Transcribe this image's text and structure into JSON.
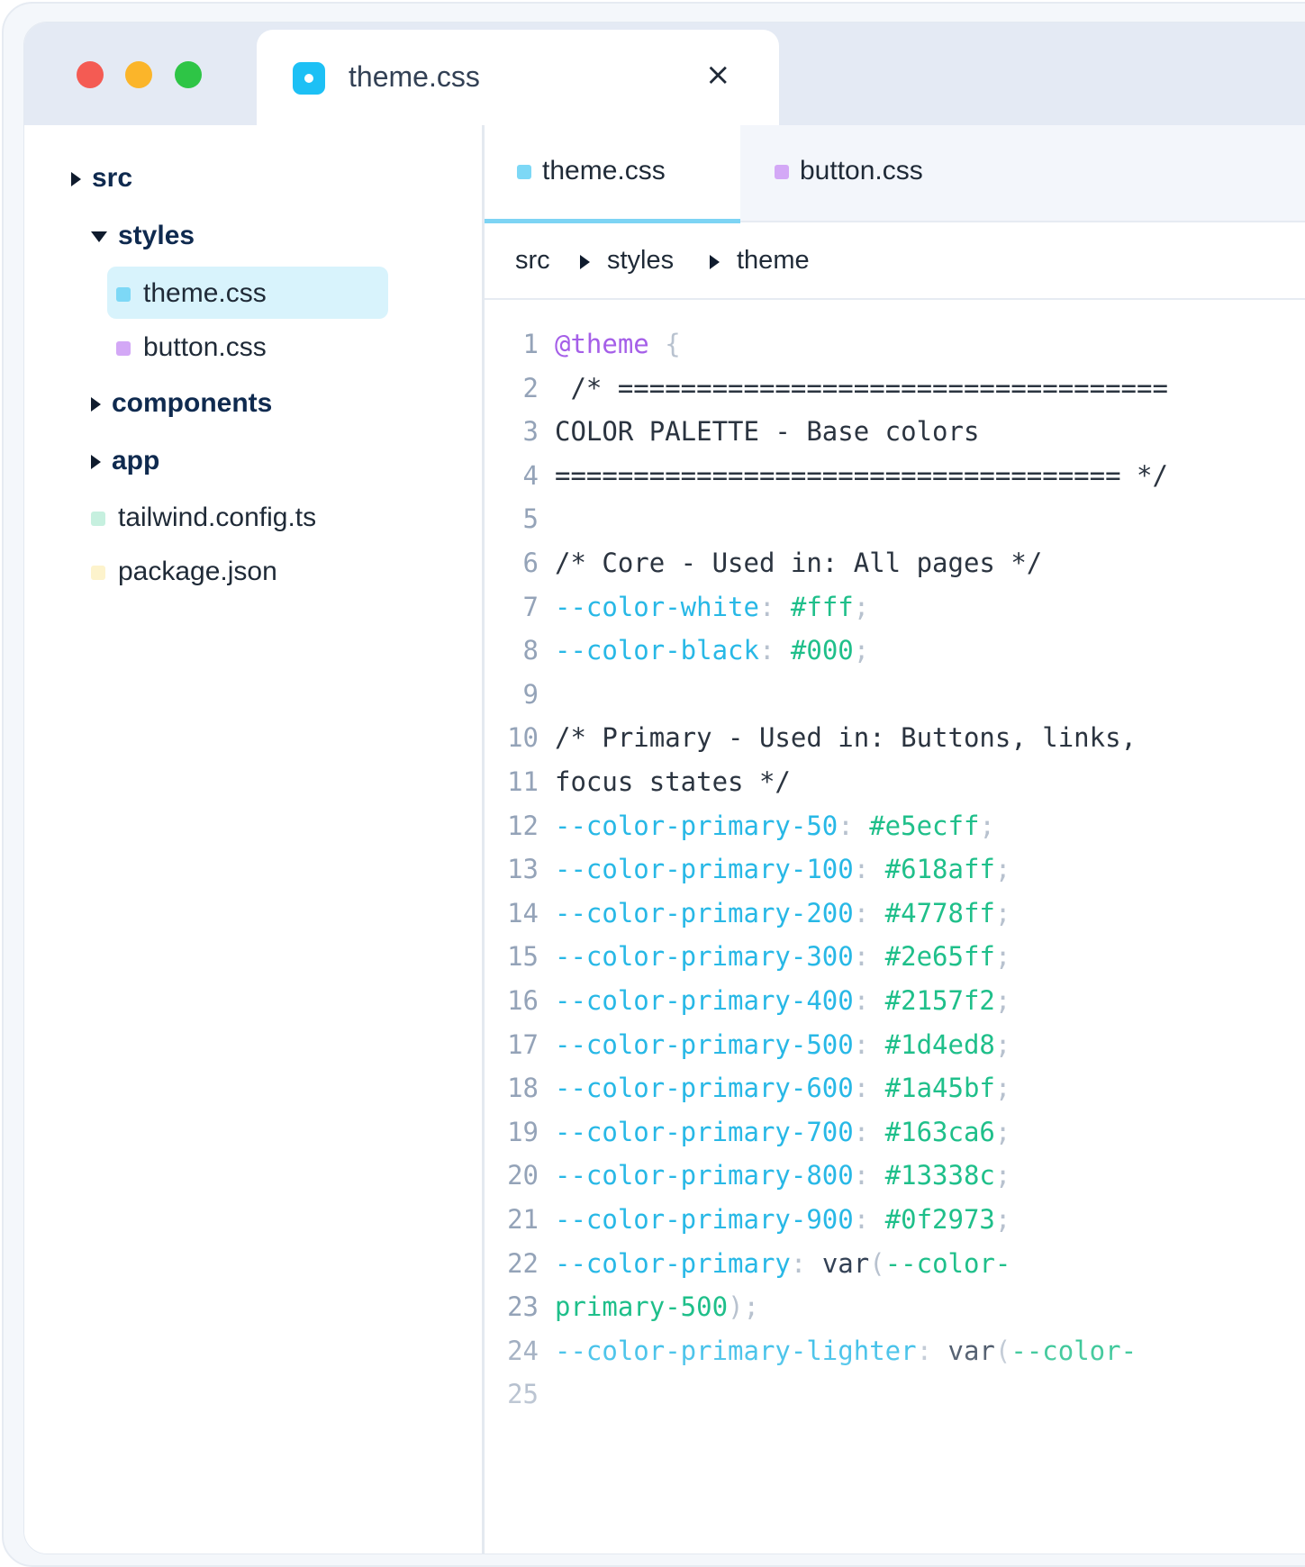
{
  "window": {
    "tab_title": "theme.css",
    "tab_icon": "css-file-icon",
    "close_symbol": "×"
  },
  "sidebar": {
    "items": [
      {
        "label": "src",
        "type": "folder",
        "state": "collapsed"
      },
      {
        "label": "styles",
        "type": "folder",
        "state": "expanded"
      },
      {
        "label": "theme.css",
        "type": "file",
        "color": "#7dd8f6",
        "selected": true
      },
      {
        "label": "button.css",
        "type": "file",
        "color": "#d3a8f6"
      },
      {
        "label": "components",
        "type": "folder",
        "state": "collapsed"
      },
      {
        "label": "app",
        "type": "folder",
        "state": "collapsed"
      },
      {
        "label": "tailwind.config.ts",
        "type": "file",
        "color": "#c6f0df"
      },
      {
        "label": "package.json",
        "type": "file",
        "color": "#fdf3cc"
      }
    ]
  },
  "editor": {
    "tabs": [
      {
        "label": "theme.css",
        "color": "#7dd8f6",
        "active": true
      },
      {
        "label": "button.css",
        "color": "#d3a8f6",
        "active": false
      }
    ],
    "breadcrumb": [
      "src",
      "styles",
      "theme"
    ],
    "lines": [
      {
        "n": "1",
        "tokens": [
          {
            "t": "@theme",
            "c": "at"
          },
          {
            "t": " {",
            "c": "brace"
          }
        ]
      },
      {
        "n": "2",
        "tokens": [
          {
            "t": " /* ===================================",
            "c": "cm"
          }
        ]
      },
      {
        "n": "3",
        "tokens": [
          {
            "t": "COLOR PALETTE - Base colors",
            "c": "cm"
          }
        ]
      },
      {
        "n": "4",
        "tokens": [
          {
            "t": "==================================== */",
            "c": "cm"
          }
        ]
      },
      {
        "n": "5",
        "tokens": []
      },
      {
        "n": "6",
        "tokens": [
          {
            "t": "/* Core - Used in: All pages */",
            "c": "cm"
          }
        ]
      },
      {
        "n": "7",
        "tokens": [
          {
            "t": "--color-white",
            "c": "prop"
          },
          {
            "t": ": ",
            "c": "punc"
          },
          {
            "t": "#fff",
            "c": "val"
          },
          {
            "t": ";",
            "c": "punc"
          }
        ]
      },
      {
        "n": "8",
        "tokens": [
          {
            "t": "--color-black",
            "c": "prop"
          },
          {
            "t": ": ",
            "c": "punc"
          },
          {
            "t": "#000",
            "c": "val"
          },
          {
            "t": ";",
            "c": "punc"
          }
        ]
      },
      {
        "n": "9",
        "tokens": []
      },
      {
        "n": "10",
        "tokens": [
          {
            "t": "/* Primary - Used in: Buttons, links,",
            "c": "cm"
          }
        ]
      },
      {
        "n": "11",
        "tokens": [
          {
            "t": "focus states */",
            "c": "cm"
          }
        ]
      },
      {
        "n": "12",
        "tokens": [
          {
            "t": "--color-primary-50",
            "c": "prop"
          },
          {
            "t": ": ",
            "c": "punc"
          },
          {
            "t": "#e5ecff",
            "c": "val"
          },
          {
            "t": ";",
            "c": "punc"
          }
        ]
      },
      {
        "n": "13",
        "tokens": [
          {
            "t": "--color-primary-100",
            "c": "prop"
          },
          {
            "t": ": ",
            "c": "punc"
          },
          {
            "t": "#618aff",
            "c": "val"
          },
          {
            "t": ";",
            "c": "punc"
          }
        ]
      },
      {
        "n": "14",
        "tokens": [
          {
            "t": "--color-primary-200",
            "c": "prop"
          },
          {
            "t": ": ",
            "c": "punc"
          },
          {
            "t": "#4778ff",
            "c": "val"
          },
          {
            "t": ";",
            "c": "punc"
          }
        ]
      },
      {
        "n": "15",
        "tokens": [
          {
            "t": "--color-primary-300",
            "c": "prop"
          },
          {
            "t": ": ",
            "c": "punc"
          },
          {
            "t": "#2e65ff",
            "c": "val"
          },
          {
            "t": ";",
            "c": "punc"
          }
        ]
      },
      {
        "n": "16",
        "tokens": [
          {
            "t": "--color-primary-400",
            "c": "prop"
          },
          {
            "t": ": ",
            "c": "punc"
          },
          {
            "t": "#2157f2",
            "c": "val"
          },
          {
            "t": ";",
            "c": "punc"
          }
        ]
      },
      {
        "n": "17",
        "tokens": [
          {
            "t": "--color-primary-500",
            "c": "prop"
          },
          {
            "t": ": ",
            "c": "punc"
          },
          {
            "t": "#1d4ed8",
            "c": "val"
          },
          {
            "t": ";",
            "c": "punc"
          }
        ]
      },
      {
        "n": "18",
        "tokens": [
          {
            "t": "--color-primary-600",
            "c": "prop"
          },
          {
            "t": ": ",
            "c": "punc"
          },
          {
            "t": "#1a45bf",
            "c": "val"
          },
          {
            "t": ";",
            "c": "punc"
          }
        ]
      },
      {
        "n": "19",
        "tokens": [
          {
            "t": "--color-primary-700",
            "c": "prop"
          },
          {
            "t": ": ",
            "c": "punc"
          },
          {
            "t": "#163ca6",
            "c": "val"
          },
          {
            "t": ";",
            "c": "punc"
          }
        ]
      },
      {
        "n": "20",
        "tokens": [
          {
            "t": "--color-primary-800",
            "c": "prop"
          },
          {
            "t": ": ",
            "c": "punc"
          },
          {
            "t": "#13338c",
            "c": "val"
          },
          {
            "t": ";",
            "c": "punc"
          }
        ]
      },
      {
        "n": "21",
        "tokens": [
          {
            "t": "--color-primary-900",
            "c": "prop"
          },
          {
            "t": ": ",
            "c": "punc"
          },
          {
            "t": "#0f2973",
            "c": "val"
          },
          {
            "t": ";",
            "c": "punc"
          }
        ]
      },
      {
        "n": "22",
        "tokens": [
          {
            "t": "--color-primary",
            "c": "prop"
          },
          {
            "t": ": ",
            "c": "punc"
          },
          {
            "t": "var",
            "c": "kw"
          },
          {
            "t": "(",
            "c": "punc"
          },
          {
            "t": "--color-",
            "c": "val"
          }
        ]
      },
      {
        "n": "23",
        "tokens": [
          {
            "t": "primary-500",
            "c": "val"
          },
          {
            "t": ");",
            "c": "punc"
          }
        ]
      },
      {
        "n": "24",
        "tokens": [
          {
            "t": "--color-primary-lighter",
            "c": "prop"
          },
          {
            "t": ": ",
            "c": "punc"
          },
          {
            "t": "var",
            "c": "kw"
          },
          {
            "t": "(",
            "c": "punc"
          },
          {
            "t": "--color-",
            "c": "val"
          }
        ]
      },
      {
        "n": "25",
        "tokens": []
      }
    ]
  }
}
